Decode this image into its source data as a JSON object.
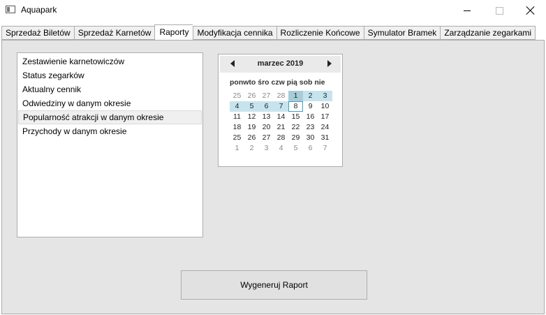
{
  "window": {
    "title": "Aquapark",
    "icons": {
      "app": "window-app-icon",
      "minimize": "minimize-icon",
      "maximize": "maximize-icon",
      "close": "close-icon"
    }
  },
  "tabs": [
    {
      "label": "Sprzedaż Biletów",
      "active": false
    },
    {
      "label": "Sprzedaż Karnetów",
      "active": false
    },
    {
      "label": "Raporty",
      "active": true
    },
    {
      "label": "Modyfikacja cennika",
      "active": false
    },
    {
      "label": "Rozliczenie Końcowe",
      "active": false
    },
    {
      "label": "Symulator Bramek",
      "active": false
    },
    {
      "label": "Zarządzanie zegarkami",
      "active": false
    }
  ],
  "reports": {
    "items": [
      "Zestawienie karnetowiczów",
      "Status zegarków",
      "Aktualny cennik",
      "Odwiedziny w danym okresie",
      "Popularność atrakcji w danym okresie",
      "Przychody w danym okresie"
    ],
    "selected_index": 4
  },
  "calendar": {
    "month_label": "marzec 2019",
    "prev_icon": "triangle-left-icon",
    "next_icon": "triangle-right-icon",
    "day_header": "ponwto śro czw pią sob nie",
    "weeks": [
      [
        "25",
        "26",
        "27",
        "28",
        "1",
        "2",
        "3"
      ],
      [
        "4",
        "5",
        "6",
        "7",
        "8",
        "9",
        "10"
      ],
      [
        "11",
        "12",
        "13",
        "14",
        "15",
        "16",
        "17"
      ],
      [
        "18",
        "19",
        "20",
        "21",
        "22",
        "23",
        "24"
      ],
      [
        "25",
        "26",
        "27",
        "28",
        "29",
        "30",
        "31"
      ],
      [
        "1",
        "2",
        "3",
        "4",
        "5",
        "6",
        "7"
      ]
    ],
    "colors": {
      "highlight": "#c6e4ee",
      "first_selected": "#a8ccd8",
      "today_border": "#3e9fc4"
    }
  },
  "generate_button": {
    "label": "Wygeneruj Raport"
  }
}
